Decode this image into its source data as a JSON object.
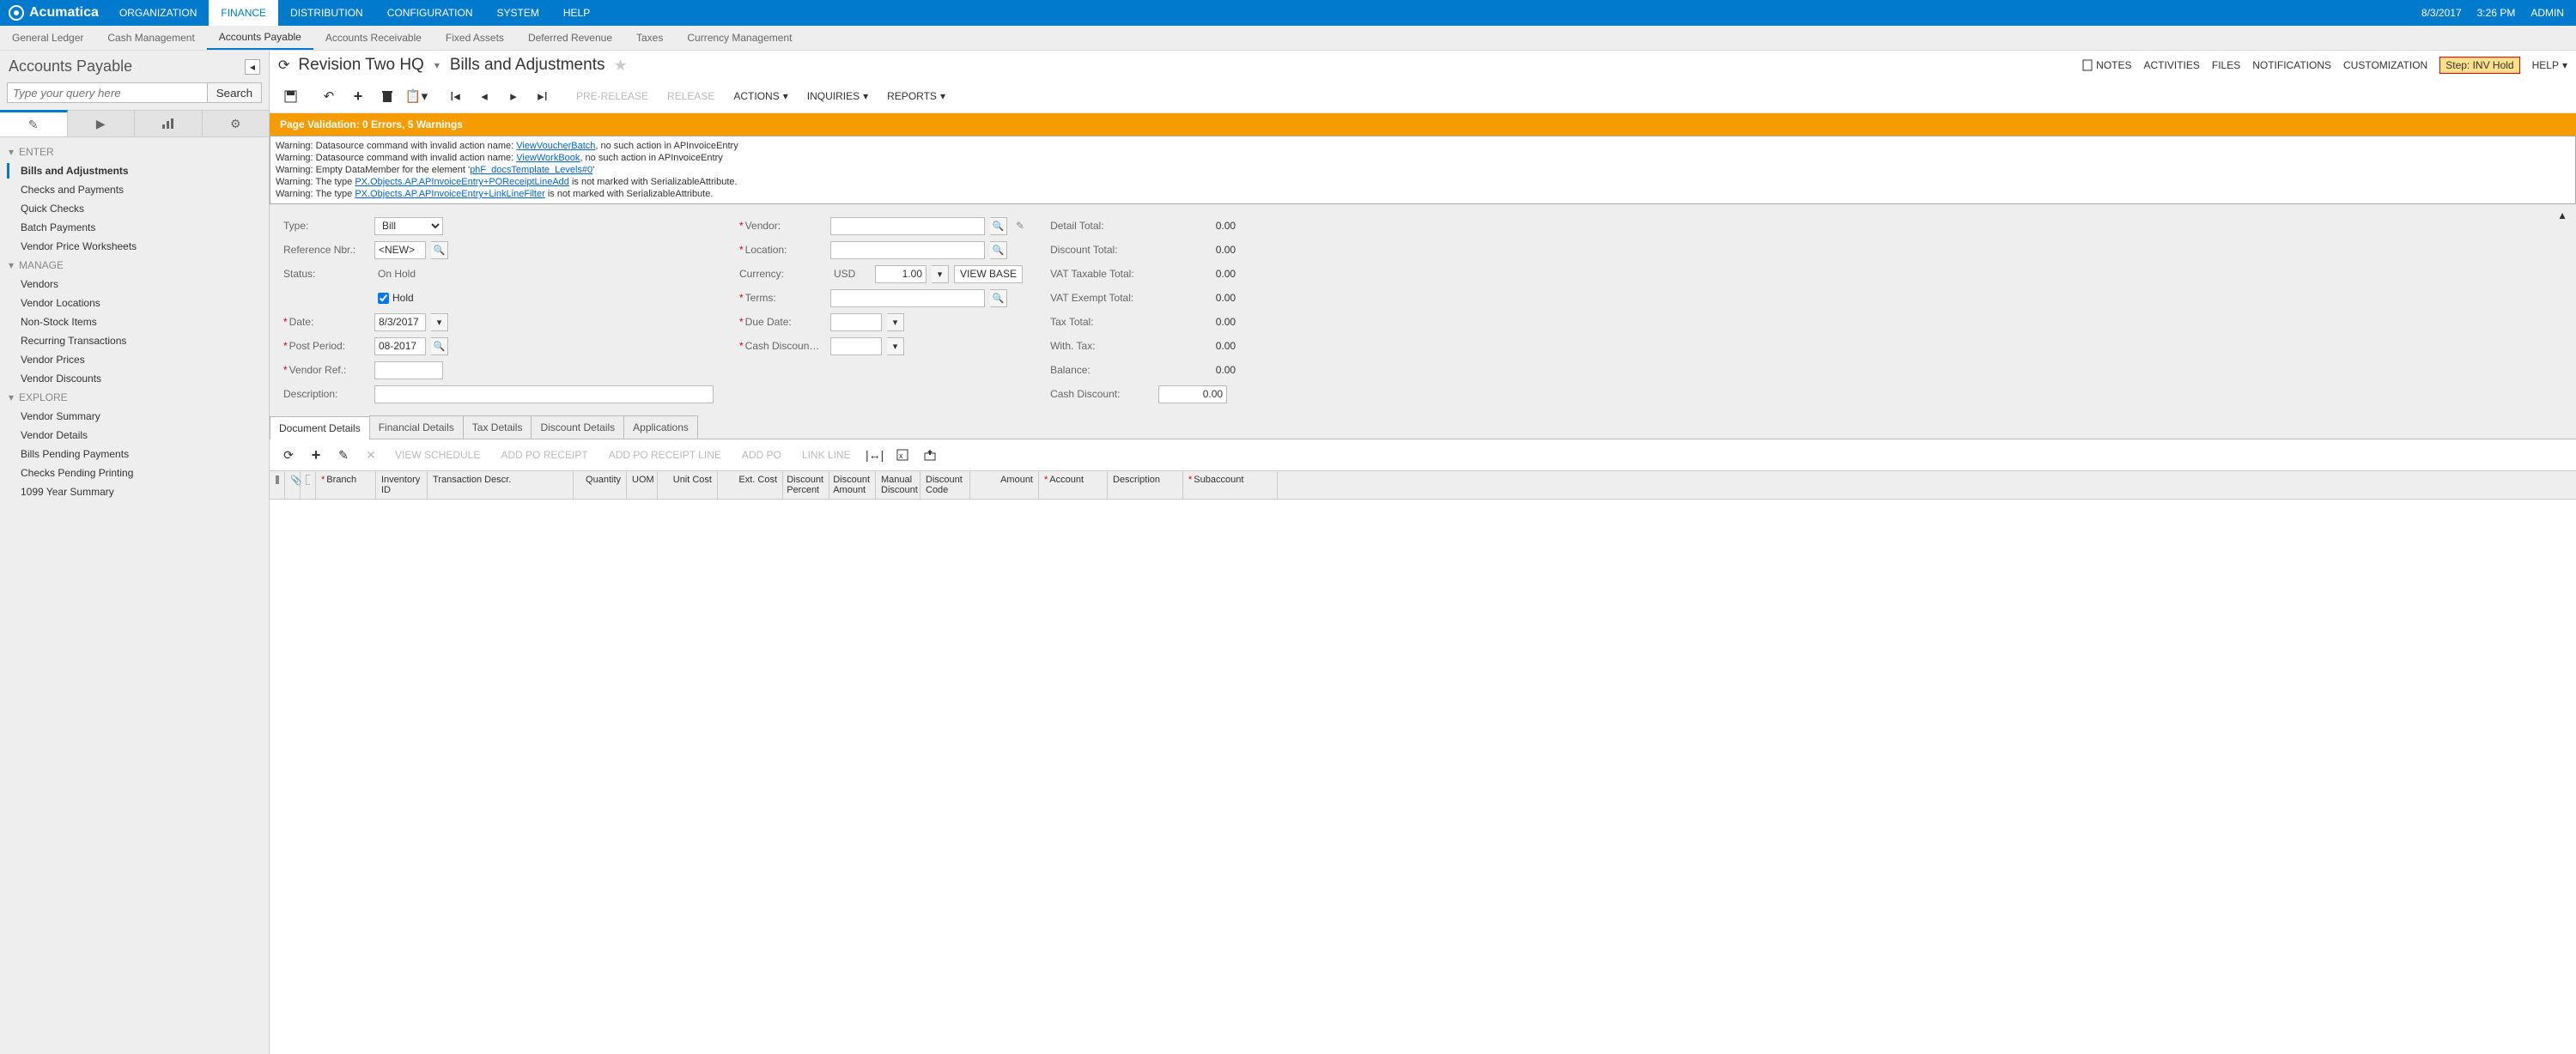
{
  "brand": "Acumatica",
  "top_right": {
    "date": "8/3/2017",
    "time": "3:26 PM",
    "user": "ADMIN"
  },
  "top_nav": [
    "ORGANIZATION",
    "FINANCE",
    "DISTRIBUTION",
    "CONFIGURATION",
    "SYSTEM",
    "HELP"
  ],
  "top_nav_active": 1,
  "sub_nav": [
    "General Ledger",
    "Cash Management",
    "Accounts Payable",
    "Accounts Receivable",
    "Fixed Assets",
    "Deferred Revenue",
    "Taxes",
    "Currency Management"
  ],
  "sub_nav_active": 2,
  "left": {
    "title": "Accounts Payable",
    "search_placeholder": "Type your query here",
    "search_btn": "Search",
    "groups": [
      {
        "label": "ENTER",
        "items": [
          "Bills and Adjustments",
          "Checks and Payments",
          "Quick Checks",
          "Batch Payments",
          "Vendor Price Worksheets"
        ],
        "active": 0
      },
      {
        "label": "MANAGE",
        "items": [
          "Vendors",
          "Vendor Locations",
          "Non-Stock Items",
          "Recurring Transactions",
          "Vendor Prices",
          "Vendor Discounts"
        ],
        "active": -1
      },
      {
        "label": "EXPLORE",
        "items": [
          "Vendor Summary",
          "Vendor Details",
          "Bills Pending Payments",
          "Checks Pending Printing",
          "1099 Year Summary"
        ],
        "active": -1
      }
    ]
  },
  "breadcrumb": {
    "company": "Revision Two HQ",
    "page": "Bills and Adjustments"
  },
  "header_right": {
    "notes": "NOTES",
    "activities": "ACTIVITIES",
    "files": "FILES",
    "notifications": "NOTIFICATIONS",
    "customization": "CUSTOMIZATION",
    "step": "Step: INV Hold",
    "help": "HELP"
  },
  "toolbar_text": {
    "pre_release": "PRE-RELEASE",
    "release": "RELEASE",
    "actions": "ACTIONS",
    "inquiries": "INQUIRIES",
    "reports": "REPORTS"
  },
  "validation": {
    "summary": "Page Validation: 0 Errors, 5 Warnings",
    "lines": [
      {
        "pre": "Warning: Datasource command with invalid action name: ",
        "link": "ViewVoucherBatch",
        "post": ", no such action in APInvoiceEntry"
      },
      {
        "pre": "Warning: Datasource command with invalid action name: ",
        "link": "ViewWorkBook",
        "post": ", no such action in APInvoiceEntry"
      },
      {
        "pre": "Warning: Empty DataMember for the element '",
        "link": "phF_docsTemplate_Levels#0",
        "post": "'"
      },
      {
        "pre": "Warning: The type ",
        "link": "PX.Objects.AP.APInvoiceEntry+POReceiptLineAdd",
        "post": " is not marked with SerializableAttribute."
      },
      {
        "pre": "Warning: The type ",
        "link": "PX.Objects.AP.APInvoiceEntry+LinkLineFilter",
        "post": " is not marked with SerializableAttribute."
      }
    ]
  },
  "form": {
    "labels": {
      "type": "Type:",
      "ref_nbr": "Reference Nbr.:",
      "status": "Status:",
      "hold": "Hold",
      "date": "Date:",
      "post_period": "Post Period:",
      "vendor_ref": "Vendor Ref.:",
      "description": "Description:",
      "vendor": "Vendor:",
      "location": "Location:",
      "currency": "Currency:",
      "terms": "Terms:",
      "due_date": "Due Date:",
      "cash_discount": "Cash Discoun…",
      "view_base": "VIEW BASE",
      "detail_total": "Detail Total:",
      "discount_total": "Discount Total:",
      "vat_taxable": "VAT Taxable Total:",
      "vat_exempt": "VAT Exempt Total:",
      "tax_total": "Tax Total:",
      "with_tax": "With. Tax:",
      "balance": "Balance:",
      "cash_disc": "Cash Discount:"
    },
    "values": {
      "type": "Bill",
      "ref_nbr": "<NEW>",
      "status": "On Hold",
      "hold_checked": true,
      "date": "8/3/2017",
      "post_period": "08-2017",
      "vendor": "",
      "location": "",
      "currency": "USD",
      "rate": "1.00",
      "terms": "",
      "due_date": "",
      "cash_discount_date": "",
      "vendor_ref": "",
      "description": "",
      "detail_total": "0.00",
      "discount_total": "0.00",
      "vat_taxable": "0.00",
      "vat_exempt": "0.00",
      "tax_total": "0.00",
      "with_tax": "0.00",
      "balance": "0.00",
      "cash_disc": "0.00"
    }
  },
  "doc_tabs": [
    "Document Details",
    "Financial Details",
    "Tax Details",
    "Discount Details",
    "Applications"
  ],
  "doc_tabs_active": 0,
  "grid_toolbar": {
    "view_schedule": "VIEW SCHEDULE",
    "add_po_receipt": "ADD PO RECEIPT",
    "add_po_receipt_line": "ADD PO RECEIPT LINE",
    "add_po": "ADD PO",
    "link_line": "LINK LINE"
  },
  "grid_columns": [
    {
      "label": "Branch",
      "req": true,
      "w": 70
    },
    {
      "label": "Inventory ID",
      "req": false,
      "w": 60
    },
    {
      "label": "Transaction Descr.",
      "req": false,
      "w": 170
    },
    {
      "label": "Quantity",
      "req": false,
      "w": 62,
      "align": "right"
    },
    {
      "label": "UOM",
      "req": false,
      "w": 36
    },
    {
      "label": "Unit Cost",
      "req": false,
      "w": 70,
      "align": "right"
    },
    {
      "label": "Ext. Cost",
      "req": false,
      "w": 76,
      "align": "right"
    },
    {
      "label": "Discount Percent",
      "req": false,
      "w": 54,
      "align": "right"
    },
    {
      "label": "Discount Amount",
      "req": false,
      "w": 54,
      "align": "right"
    },
    {
      "label": "Manual Discount",
      "req": false,
      "w": 52
    },
    {
      "label": "Discount Code",
      "req": false,
      "w": 58
    },
    {
      "label": "Amount",
      "req": false,
      "w": 80,
      "align": "right"
    },
    {
      "label": "Account",
      "req": true,
      "w": 80
    },
    {
      "label": "Description",
      "req": false,
      "w": 88
    },
    {
      "label": "Subaccount",
      "req": true,
      "w": 110
    }
  ]
}
